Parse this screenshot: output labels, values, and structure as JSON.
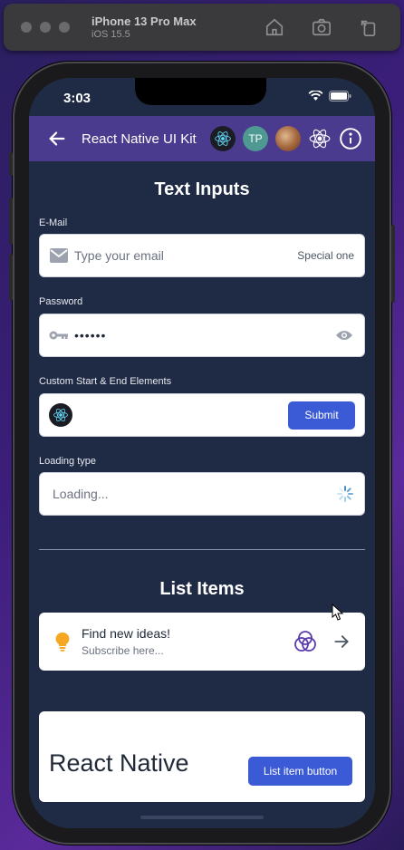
{
  "simulator": {
    "device_name": "iPhone 13 Pro Max",
    "os_version": "iOS 15.5",
    "icons": [
      "home-icon",
      "screenshot-icon",
      "rotate-icon"
    ]
  },
  "status_bar": {
    "time": "3:03"
  },
  "app_bar": {
    "title": "React Native UI Kit",
    "avatar_initials": "TP",
    "colors": {
      "background": "#4b3b8e",
      "tp_avatar": "#4e9a92"
    }
  },
  "text_inputs": {
    "heading": "Text Inputs",
    "email": {
      "label": "E-Mail",
      "placeholder": "Type your email",
      "end_text": "Special one"
    },
    "password": {
      "label": "Password",
      "value": "••••••"
    },
    "custom": {
      "label": "Custom Start & End Elements",
      "button": "Submit"
    },
    "loading": {
      "label": "Loading type",
      "placeholder": "Loading..."
    }
  },
  "list_items": {
    "heading": "List Items",
    "item": {
      "title": "Find new ideas!",
      "subtitle": "Subscribe here..."
    },
    "card": {
      "title": "React Native",
      "button": "List item button"
    }
  },
  "colors": {
    "accent": "#3b5bd6",
    "screen_bg": "#1f2a44"
  }
}
